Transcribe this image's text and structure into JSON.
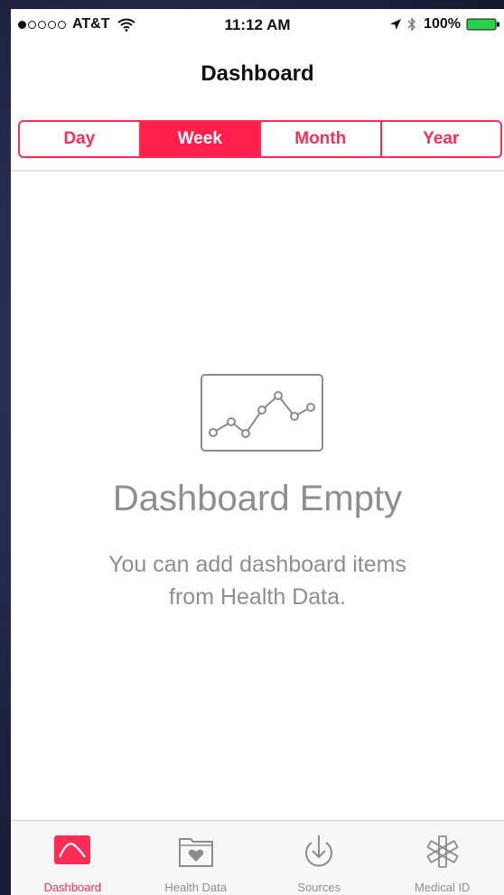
{
  "status_bar": {
    "carrier": "AT&T",
    "time": "11:12 AM",
    "battery": "100%",
    "signal_bars_filled": 1,
    "signal_bars_total": 5
  },
  "nav": {
    "title": "Dashboard"
  },
  "segments": [
    {
      "label": "Day",
      "active": false
    },
    {
      "label": "Week",
      "active": true
    },
    {
      "label": "Month",
      "active": false
    },
    {
      "label": "Year",
      "active": false
    }
  ],
  "empty_state": {
    "icon": "line-chart-icon",
    "title": "Dashboard Empty",
    "message_line1": "You can add dashboard items",
    "message_line2": "from Health Data."
  },
  "tab_bar": {
    "tabs": [
      {
        "label": "Dashboard",
        "icon": "dashboard-chart-icon",
        "active": true
      },
      {
        "label": "Health Data",
        "icon": "health-data-folder-icon",
        "active": false
      },
      {
        "label": "Sources",
        "icon": "sources-download-icon",
        "active": false
      },
      {
        "label": "Medical ID",
        "icon": "medical-id-star-icon",
        "active": false
      }
    ]
  },
  "colors": {
    "accent": "#ff2d55",
    "active_segment_bg": "#ff1f4c",
    "muted_text": "#8e8e8e",
    "icon_gray": "#8c8c8c",
    "tab_bar_bg": "#f7f7f8"
  }
}
